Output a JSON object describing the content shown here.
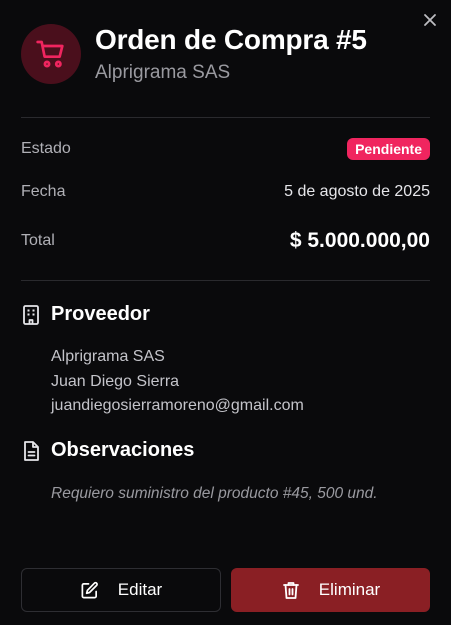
{
  "header": {
    "title": "Orden de Compra #5",
    "subtitle": "Alprigrama SAS",
    "icon": "shopping-cart-icon",
    "icon_color": "#f0255f",
    "icon_bg": "#4a0f1c"
  },
  "details": {
    "status_label": "Estado",
    "status_value": "Pendiente",
    "status_color": "#f0255f",
    "date_label": "Fecha",
    "date_value": "5 de agosto de 2025",
    "total_label": "Total",
    "total_value": "$ 5.000.000,00"
  },
  "supplier": {
    "heading": "Proveedor",
    "icon": "building-icon",
    "company": "Alprigrama SAS",
    "contact": "Juan Diego Sierra",
    "email": "juandiegosierramoreno@gmail.com"
  },
  "observations": {
    "heading": "Observaciones",
    "icon": "document-icon",
    "text": "Requiero suministro del producto #45, 500 und."
  },
  "actions": {
    "edit_label": "Editar",
    "edit_icon": "edit-icon",
    "delete_label": "Eliminar",
    "delete_icon": "trash-icon",
    "delete_color": "#8a1f24"
  },
  "close_icon": "close-icon"
}
